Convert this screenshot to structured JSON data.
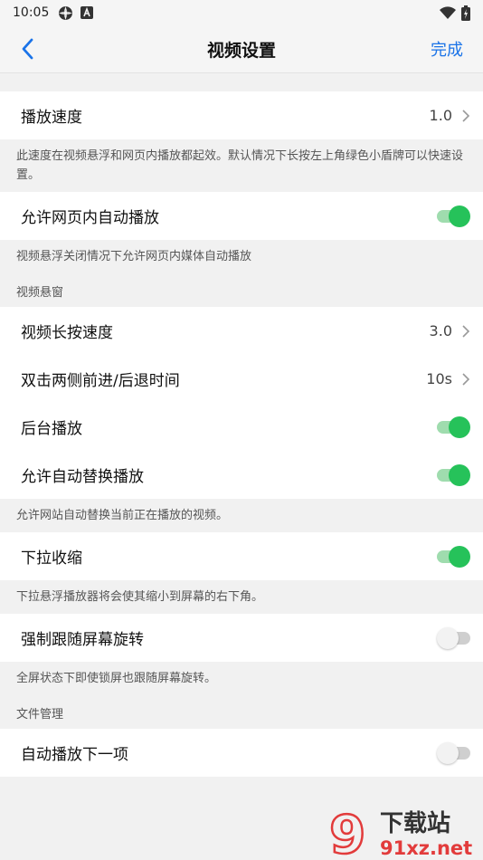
{
  "status": {
    "time": "10:05"
  },
  "nav": {
    "title": "视频设置",
    "done": "完成"
  },
  "rows": {
    "speed": {
      "label": "播放速度",
      "value": "1.0"
    },
    "autoplay_web": {
      "label": "允许网页内自动播放"
    },
    "long_press": {
      "label": "视频长按速度",
      "value": "3.0"
    },
    "double_tap": {
      "label": "双击两侧前进/后退时间",
      "value": "10s"
    },
    "background": {
      "label": "后台播放"
    },
    "auto_replace": {
      "label": "允许自动替换播放"
    },
    "pull_shrink": {
      "label": "下拉收缩"
    },
    "force_rotate": {
      "label": "强制跟随屏幕旋转"
    },
    "autoplay_next": {
      "label": "自动播放下一项"
    }
  },
  "toggles": {
    "autoplay_web": true,
    "background": true,
    "auto_replace": true,
    "pull_shrink": true,
    "force_rotate": false,
    "autoplay_next": false
  },
  "descs": {
    "speed": "此速度在视频悬浮和网页内播放都起效。默认情况下长按左上角绿色小盾牌可以快速设置。",
    "autoplay_web": "视频悬浮关闭情况下允许网页内媒体自动播放",
    "auto_replace": "允许网站自动替换当前正在播放的视频。",
    "pull_shrink": "下拉悬浮播放器将会使其缩小到屏幕的右下角。",
    "force_rotate": "全屏状态下即使锁屏也跟随屏幕旋转。"
  },
  "sections": {
    "float_window": "视频悬窗",
    "file_manage": "文件管理"
  },
  "watermark": {
    "brand_cn": "下载站",
    "brand_en": "91xz.net",
    "logo_glyph": "9"
  },
  "colors": {
    "accent": "#1a73e8",
    "toggle_on": "#26c25a",
    "toggle_on_track": "#9fdcae",
    "watermark_red": "#e23b3b"
  },
  "icons": [
    "back-chevron-icon",
    "chevron-right-icon",
    "wifi-icon",
    "battery-icon",
    "settings-icon",
    "font-icon"
  ]
}
